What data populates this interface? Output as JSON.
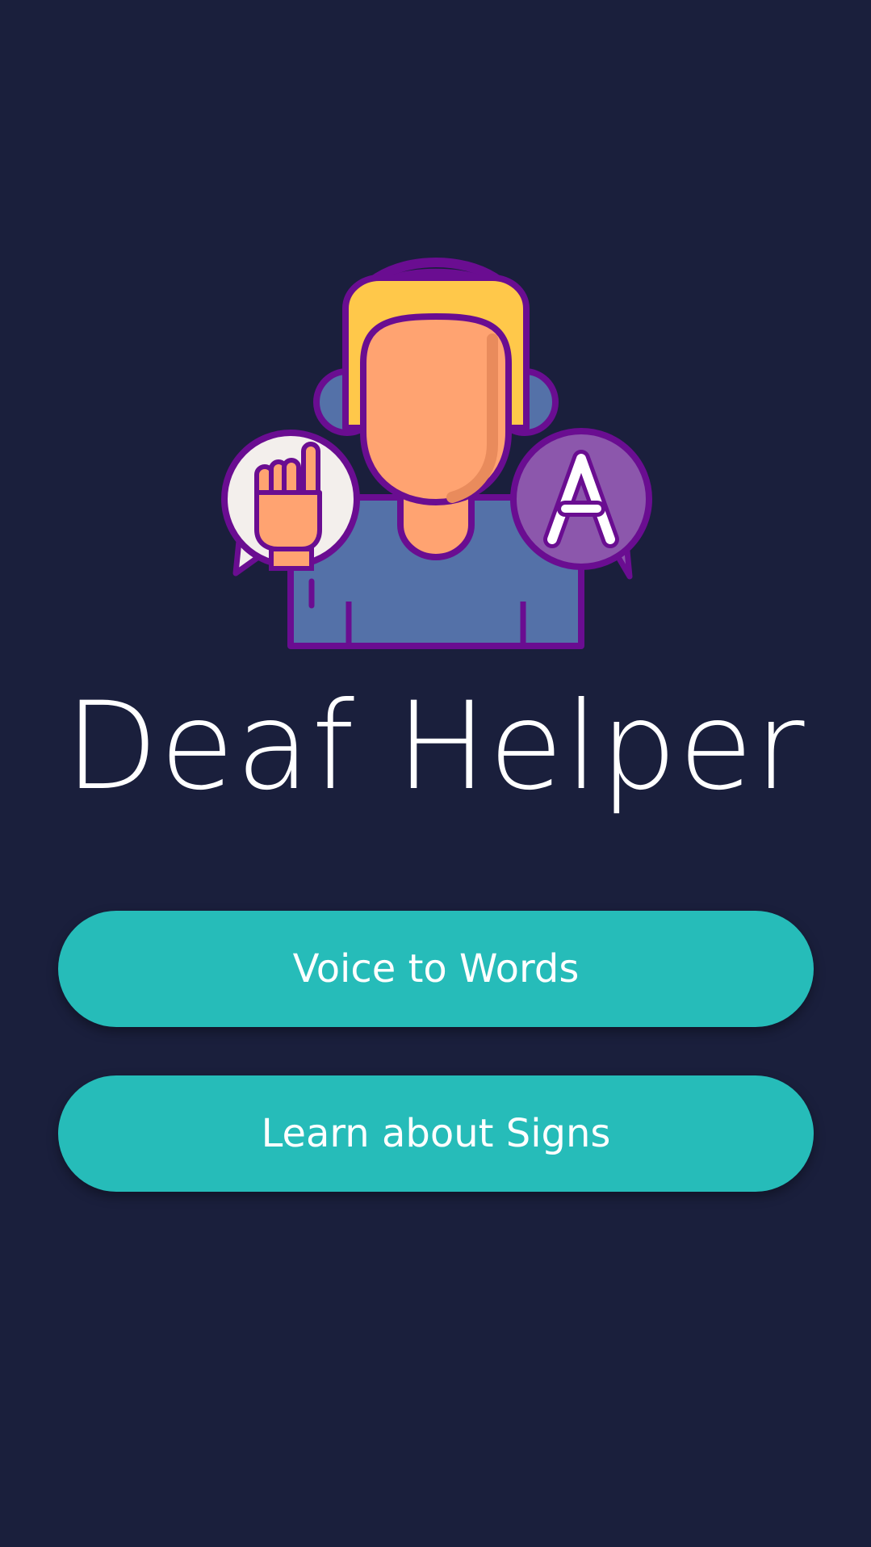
{
  "app": {
    "title": "Deaf Helper",
    "logo_icon": "deaf-person-signing-icon",
    "logo_bubble_letter": "A"
  },
  "menu": {
    "voice_to_words_label": "Voice to Words",
    "learn_signs_label": "Learn about Signs"
  },
  "colors": {
    "background": "#1a1f3c",
    "button": "#26bcb9",
    "text": "#ffffff",
    "outline": "#6a0d91",
    "hair": "#ffc84a",
    "skin": "#ffa371",
    "shirt": "#5471a8",
    "bubble_right": "#8c57ac",
    "bubble_left": "#f3efec"
  }
}
